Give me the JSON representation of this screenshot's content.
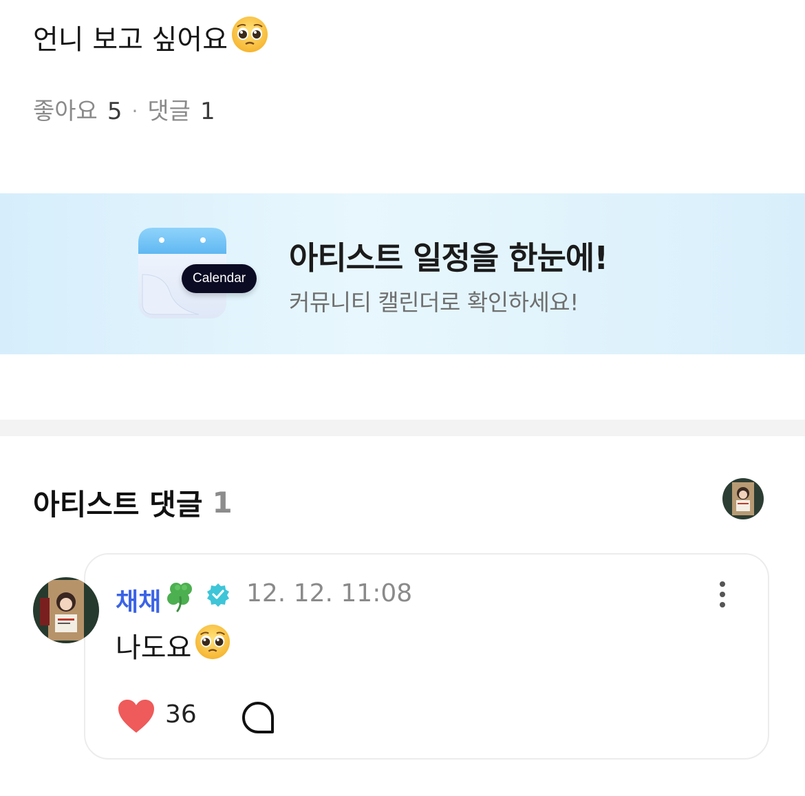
{
  "post": {
    "text": "언니 보고 싶어요",
    "emoji": "pleading-face-emoji"
  },
  "stats": {
    "likes_label": "좋아요",
    "likes_count": "5",
    "separator": "·",
    "comments_label": "댓글",
    "comments_count": "1"
  },
  "banner": {
    "badge": "Calendar",
    "title": "아티스트 일정을 한눈에!",
    "subtitle": "커뮤니티 캘린더로 확인하세요!"
  },
  "artist_comments": {
    "title": "아티스트 댓글",
    "count": "1"
  },
  "comment": {
    "author": "채채",
    "author_emoji": "four-leaf-clover-emoji",
    "verified": true,
    "time": "12. 12. 11:08",
    "text": "나도요",
    "text_emoji": "pleading-face-emoji",
    "like_count": "36"
  },
  "colors": {
    "author_name": "#3b63e6",
    "verified_badge": "#3ec5d8",
    "heart": "#ef5a5a",
    "banner_bg": "#e3f4fd",
    "calendar_badge": "#0c0b24"
  }
}
